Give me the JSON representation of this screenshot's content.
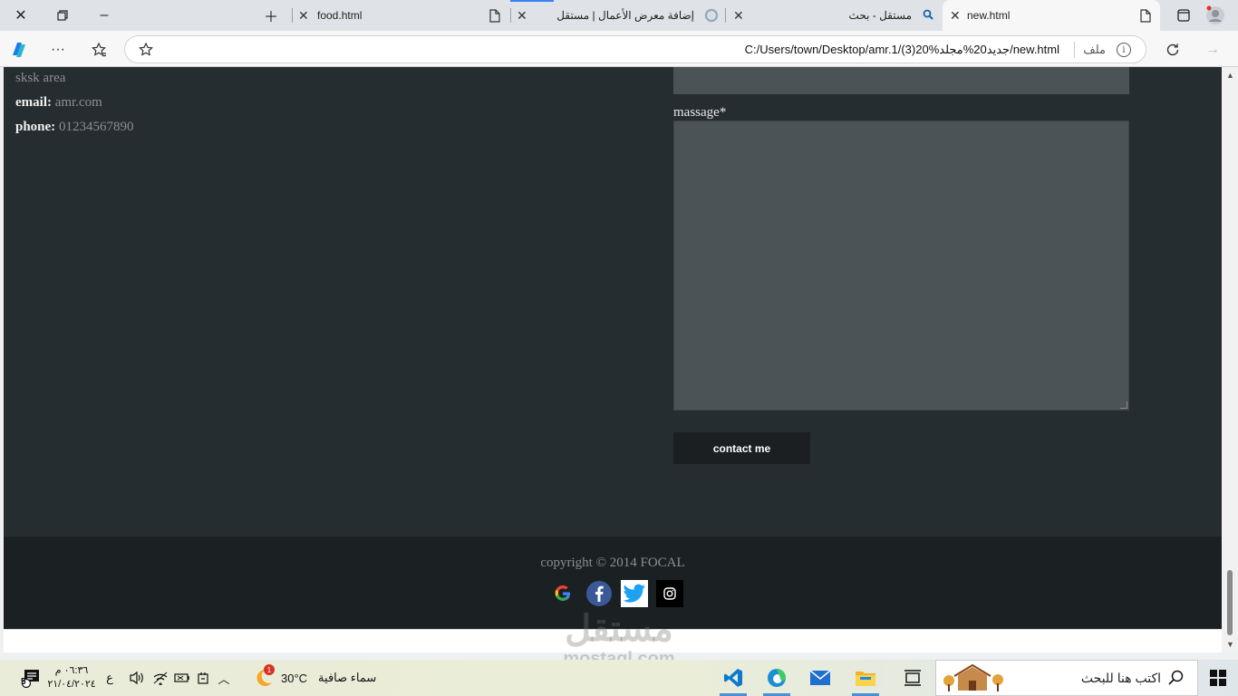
{
  "browser": {
    "tabs": [
      {
        "title": "new.html",
        "active": true
      },
      {
        "title": "مستقل - بحث",
        "active": false
      },
      {
        "title": "إضافة معرض الأعمال | مستقل",
        "active": false
      },
      {
        "title": "food.html",
        "active": false
      }
    ],
    "address": {
      "url": "C:/Users/town/Desktop/amr.1/(3)20%جديد20%مجلد/new.html",
      "scheme_label": "ملف"
    }
  },
  "page": {
    "contact_info": {
      "area": "sksk area",
      "email_label": "email:",
      "email_value": "amr.com",
      "phone_label": "phone:",
      "phone_value": "01234567890"
    },
    "form": {
      "message_label": "massage*",
      "submit_label": "contact me"
    },
    "footer": {
      "copyright": "copyright © 2014 FOCAL",
      "socials": [
        "google",
        "facebook",
        "twitter",
        "instagram"
      ]
    }
  },
  "watermark": {
    "arabic": "مستقل",
    "latin": "mostaql.com"
  },
  "taskbar": {
    "search_placeholder": "اكتب هنا للبحث",
    "weather_text": "سماء صافية",
    "temperature": "30°C",
    "weather_badge": "1",
    "time": "٠٦:٣٦ م",
    "date": "٢١/٠٤/٢٠٢٤",
    "language": "ع",
    "notification_count": "5"
  },
  "colors": {
    "page_bg": "#262d30",
    "footer_bg": "#1b2023",
    "field_bg": "#4b5357",
    "button_bg": "#1b1f21"
  }
}
